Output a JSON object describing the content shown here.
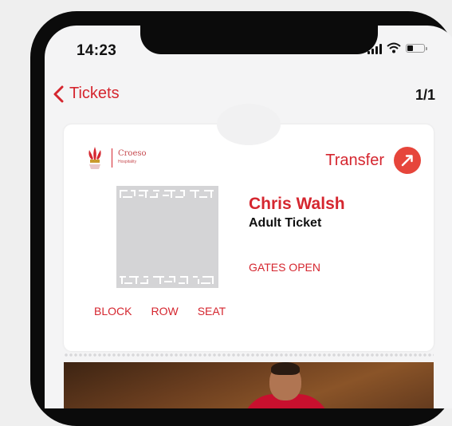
{
  "status_bar": {
    "time": "14:23"
  },
  "nav": {
    "back_label": "Tickets",
    "pager": "1/1"
  },
  "ticket": {
    "transfer_label": "Transfer",
    "holder_name": "Chris Walsh",
    "ticket_type": "Adult Ticket",
    "gates_label": "GATES OPEN",
    "seat_labels": [
      "BLOCK",
      "ROW",
      "SEAT"
    ],
    "logo_text": "Croeso",
    "logo_subtext": "Hospitality"
  },
  "colors": {
    "accent": "#d5262f",
    "transfer_button": "#e6453b",
    "jersey": "#c8102e"
  },
  "icons": {
    "back": "chevron-left-icon",
    "transfer": "transfer-arrow-icon",
    "signal": "cellular-signal-icon",
    "wifi": "wifi-icon",
    "battery": "battery-icon",
    "logo": "feathers-logo-icon",
    "code": "ticket-code"
  },
  "battery_level": 0.35
}
